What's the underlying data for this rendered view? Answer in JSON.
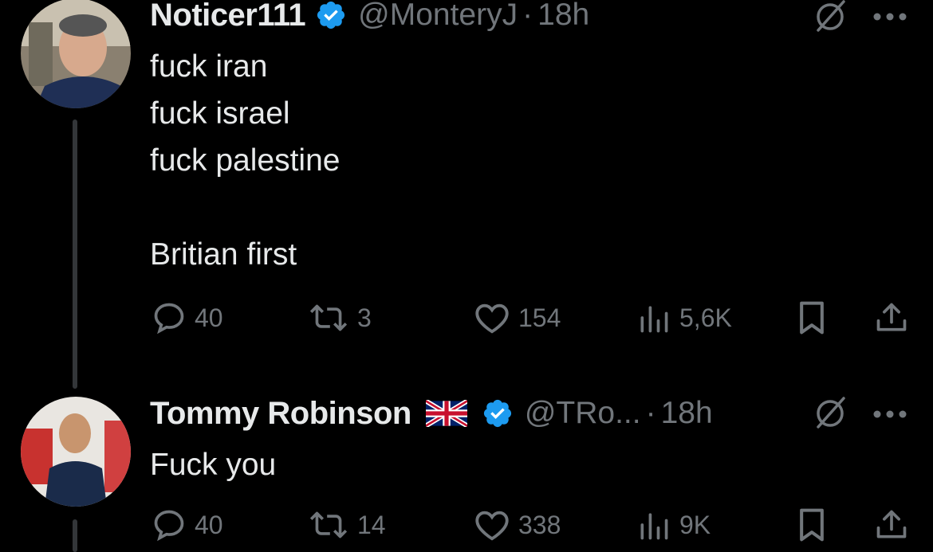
{
  "tweets": [
    {
      "name": "Noticer111",
      "handle": "@MonteryJ",
      "separator": "·",
      "time": "18h",
      "text": "fuck iran\nfuck israel\nfuck palestine\n\nBritian first",
      "stats": {
        "replies": "40",
        "reposts": "3",
        "likes": "154",
        "views": "5,6K"
      }
    },
    {
      "name": "Tommy Robinson",
      "handle": "@TRo...",
      "separator": "·",
      "time": "18h",
      "text": "Fuck you",
      "stats": {
        "replies": "40",
        "reposts": "14",
        "likes": "338",
        "views": "9K"
      }
    }
  ],
  "colors": {
    "background": "#000000",
    "text": "#e7e9ea",
    "muted": "#71767b",
    "verified": "#1d9bf0",
    "line": "#333639"
  },
  "icons": [
    "verified-badge-icon",
    "uk-flag-icon",
    "grok-icon",
    "more-icon",
    "reply-icon",
    "repost-icon",
    "like-icon",
    "views-icon",
    "bookmark-icon",
    "share-icon"
  ]
}
